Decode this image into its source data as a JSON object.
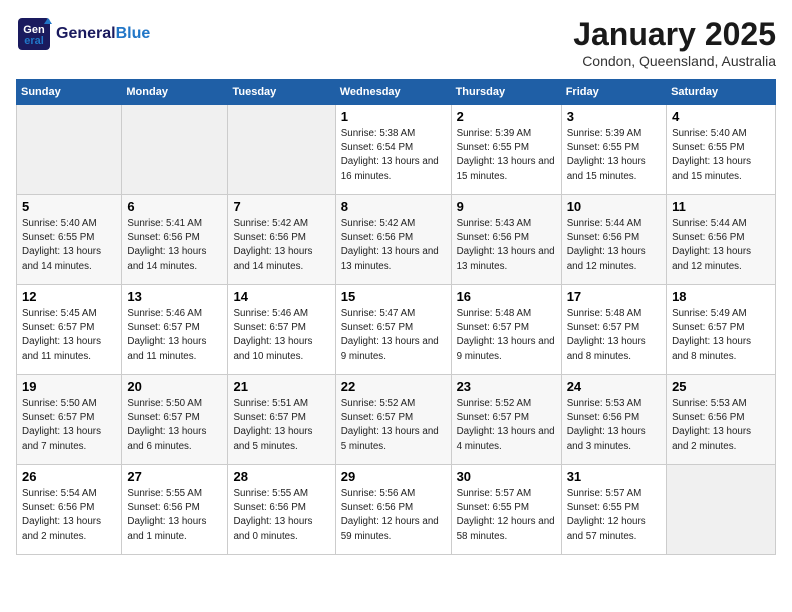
{
  "header": {
    "logo_general": "General",
    "logo_blue": "Blue",
    "month": "January 2025",
    "location": "Condon, Queensland, Australia"
  },
  "days_of_week": [
    "Sunday",
    "Monday",
    "Tuesday",
    "Wednesday",
    "Thursday",
    "Friday",
    "Saturday"
  ],
  "weeks": [
    [
      {
        "day": "",
        "empty": true
      },
      {
        "day": "",
        "empty": true
      },
      {
        "day": "",
        "empty": true
      },
      {
        "day": "1",
        "sunrise": "Sunrise: 5:38 AM",
        "sunset": "Sunset: 6:54 PM",
        "daylight": "Daylight: 13 hours and 16 minutes."
      },
      {
        "day": "2",
        "sunrise": "Sunrise: 5:39 AM",
        "sunset": "Sunset: 6:55 PM",
        "daylight": "Daylight: 13 hours and 15 minutes."
      },
      {
        "day": "3",
        "sunrise": "Sunrise: 5:39 AM",
        "sunset": "Sunset: 6:55 PM",
        "daylight": "Daylight: 13 hours and 15 minutes."
      },
      {
        "day": "4",
        "sunrise": "Sunrise: 5:40 AM",
        "sunset": "Sunset: 6:55 PM",
        "daylight": "Daylight: 13 hours and 15 minutes."
      }
    ],
    [
      {
        "day": "5",
        "sunrise": "Sunrise: 5:40 AM",
        "sunset": "Sunset: 6:55 PM",
        "daylight": "Daylight: 13 hours and 14 minutes."
      },
      {
        "day": "6",
        "sunrise": "Sunrise: 5:41 AM",
        "sunset": "Sunset: 6:56 PM",
        "daylight": "Daylight: 13 hours and 14 minutes."
      },
      {
        "day": "7",
        "sunrise": "Sunrise: 5:42 AM",
        "sunset": "Sunset: 6:56 PM",
        "daylight": "Daylight: 13 hours and 14 minutes."
      },
      {
        "day": "8",
        "sunrise": "Sunrise: 5:42 AM",
        "sunset": "Sunset: 6:56 PM",
        "daylight": "Daylight: 13 hours and 13 minutes."
      },
      {
        "day": "9",
        "sunrise": "Sunrise: 5:43 AM",
        "sunset": "Sunset: 6:56 PM",
        "daylight": "Daylight: 13 hours and 13 minutes."
      },
      {
        "day": "10",
        "sunrise": "Sunrise: 5:44 AM",
        "sunset": "Sunset: 6:56 PM",
        "daylight": "Daylight: 13 hours and 12 minutes."
      },
      {
        "day": "11",
        "sunrise": "Sunrise: 5:44 AM",
        "sunset": "Sunset: 6:56 PM",
        "daylight": "Daylight: 13 hours and 12 minutes."
      }
    ],
    [
      {
        "day": "12",
        "sunrise": "Sunrise: 5:45 AM",
        "sunset": "Sunset: 6:57 PM",
        "daylight": "Daylight: 13 hours and 11 minutes."
      },
      {
        "day": "13",
        "sunrise": "Sunrise: 5:46 AM",
        "sunset": "Sunset: 6:57 PM",
        "daylight": "Daylight: 13 hours and 11 minutes."
      },
      {
        "day": "14",
        "sunrise": "Sunrise: 5:46 AM",
        "sunset": "Sunset: 6:57 PM",
        "daylight": "Daylight: 13 hours and 10 minutes."
      },
      {
        "day": "15",
        "sunrise": "Sunrise: 5:47 AM",
        "sunset": "Sunset: 6:57 PM",
        "daylight": "Daylight: 13 hours and 9 minutes."
      },
      {
        "day": "16",
        "sunrise": "Sunrise: 5:48 AM",
        "sunset": "Sunset: 6:57 PM",
        "daylight": "Daylight: 13 hours and 9 minutes."
      },
      {
        "day": "17",
        "sunrise": "Sunrise: 5:48 AM",
        "sunset": "Sunset: 6:57 PM",
        "daylight": "Daylight: 13 hours and 8 minutes."
      },
      {
        "day": "18",
        "sunrise": "Sunrise: 5:49 AM",
        "sunset": "Sunset: 6:57 PM",
        "daylight": "Daylight: 13 hours and 8 minutes."
      }
    ],
    [
      {
        "day": "19",
        "sunrise": "Sunrise: 5:50 AM",
        "sunset": "Sunset: 6:57 PM",
        "daylight": "Daylight: 13 hours and 7 minutes."
      },
      {
        "day": "20",
        "sunrise": "Sunrise: 5:50 AM",
        "sunset": "Sunset: 6:57 PM",
        "daylight": "Daylight: 13 hours and 6 minutes."
      },
      {
        "day": "21",
        "sunrise": "Sunrise: 5:51 AM",
        "sunset": "Sunset: 6:57 PM",
        "daylight": "Daylight: 13 hours and 5 minutes."
      },
      {
        "day": "22",
        "sunrise": "Sunrise: 5:52 AM",
        "sunset": "Sunset: 6:57 PM",
        "daylight": "Daylight: 13 hours and 5 minutes."
      },
      {
        "day": "23",
        "sunrise": "Sunrise: 5:52 AM",
        "sunset": "Sunset: 6:57 PM",
        "daylight": "Daylight: 13 hours and 4 minutes."
      },
      {
        "day": "24",
        "sunrise": "Sunrise: 5:53 AM",
        "sunset": "Sunset: 6:56 PM",
        "daylight": "Daylight: 13 hours and 3 minutes."
      },
      {
        "day": "25",
        "sunrise": "Sunrise: 5:53 AM",
        "sunset": "Sunset: 6:56 PM",
        "daylight": "Daylight: 13 hours and 2 minutes."
      }
    ],
    [
      {
        "day": "26",
        "sunrise": "Sunrise: 5:54 AM",
        "sunset": "Sunset: 6:56 PM",
        "daylight": "Daylight: 13 hours and 2 minutes."
      },
      {
        "day": "27",
        "sunrise": "Sunrise: 5:55 AM",
        "sunset": "Sunset: 6:56 PM",
        "daylight": "Daylight: 13 hours and 1 minute."
      },
      {
        "day": "28",
        "sunrise": "Sunrise: 5:55 AM",
        "sunset": "Sunset: 6:56 PM",
        "daylight": "Daylight: 13 hours and 0 minutes."
      },
      {
        "day": "29",
        "sunrise": "Sunrise: 5:56 AM",
        "sunset": "Sunset: 6:56 PM",
        "daylight": "Daylight: 12 hours and 59 minutes."
      },
      {
        "day": "30",
        "sunrise": "Sunrise: 5:57 AM",
        "sunset": "Sunset: 6:55 PM",
        "daylight": "Daylight: 12 hours and 58 minutes."
      },
      {
        "day": "31",
        "sunrise": "Sunrise: 5:57 AM",
        "sunset": "Sunset: 6:55 PM",
        "daylight": "Daylight: 12 hours and 57 minutes."
      },
      {
        "day": "",
        "empty": true
      }
    ]
  ]
}
